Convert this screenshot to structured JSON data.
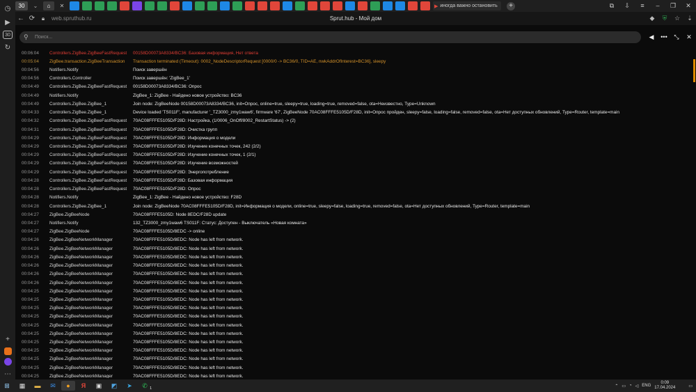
{
  "browser": {
    "url": "web.spruthub.ru",
    "page_title": "Sprut.hub - Мой дом",
    "tab_counter": "30",
    "wide_tab_label": "иногда важно остановить",
    "sidebar_counter": "30"
  },
  "search": {
    "placeholder": "Поиск..."
  },
  "log": [
    {
      "time": "00:06:04",
      "source": "Controllers.ZigBee.ZigBeeFastRequest",
      "message": "00158D00073A8334/BC36: Базовая информация, Нет ответа",
      "level": "error"
    },
    {
      "time": "00:05:04",
      "source": "ZigBee.transaction.ZigBeeTransaction",
      "message": "Transaction terminated (Timeout): 0002_NodeDescriptorRequest [0000/0 -> BC36/0, TID=AE, nwkAddrOfInterest=BC36], sleepy",
      "level": "warn"
    },
    {
      "time": "00:04:56",
      "source": "Notifiers.Notify",
      "message": "Поиск завершён",
      "level": "info"
    },
    {
      "time": "00:04:56",
      "source": "Controllers.Controller",
      "message": "Поиск завершён: 'ZigBee_1'",
      "level": "info"
    },
    {
      "time": "00:04:49",
      "source": "Controllers.ZigBee.ZigBeeFastRequest",
      "message": "00158D00073A8334/BC36: Опрос",
      "level": "info"
    },
    {
      "time": "00:04:49",
      "source": "Notifiers.Notify",
      "message": "ZigBee_1: ZigBee - Найдено новое устройство: BC36",
      "level": "info"
    },
    {
      "time": "00:04:49",
      "source": "Controllers.ZigBee.ZigBee_1",
      "message": "Join node: ZigBeeNode 00158D00073A8334/BC36, init=Опрос, online=true, sleepy=true, loading=true, removed=false, ota=Неизвестно, Type=Unknown",
      "level": "info"
    },
    {
      "time": "00:04:33",
      "source": "Controllers.ZigBee.ZigBee_1",
      "message": "Device loaded 'TS011F', manufacturer '_TZ3000_zmy1waw6', firmware '67', ZigBeeNode 70AC08FFFE5105D/F28D, init=Опрос пройден, sleepy=false, loading=false, removed=false, ota=Нет доступных обновлений, Type=Router, template=main",
      "level": "info"
    },
    {
      "time": "00:04:32",
      "source": "Controllers.ZigBee.ZigBeeFastRequest",
      "message": "70AC08FFFE5105D/F28D: Настройка, (1/0006_OnOff/8002_RestartStatus) -> (2)",
      "level": "info"
    },
    {
      "time": "00:04:31",
      "source": "Controllers.ZigBee.ZigBeeFastRequest",
      "message": "70AC08FFFE5105D/F28D: Очистка групп",
      "level": "info"
    },
    {
      "time": "00:04:29",
      "source": "Controllers.ZigBee.ZigBeeFastRequest",
      "message": "70AC08FFFE5105D/F28D: Информация о модели",
      "level": "info"
    },
    {
      "time": "00:04:29",
      "source": "Controllers.ZigBee.ZigBeeFastRequest",
      "message": "70AC08FFFE5105D/F28D: Изучение конечных точек, 242 (2/2)",
      "level": "info"
    },
    {
      "time": "00:04:29",
      "source": "Controllers.ZigBee.ZigBeeFastRequest",
      "message": "70AC08FFFE5105D/F28D: Изучение конечных точек, 1 (2/1)",
      "level": "info"
    },
    {
      "time": "00:04:29",
      "source": "Controllers.ZigBee.ZigBeeFastRequest",
      "message": "70AC08FFFE5105D/F28D: Изучение возможностей",
      "level": "info"
    },
    {
      "time": "00:04:29",
      "source": "Controllers.ZigBee.ZigBeeFastRequest",
      "message": "70AC08FFFE5105D/F28D: Энергопотребление",
      "level": "info"
    },
    {
      "time": "00:04:28",
      "source": "Controllers.ZigBee.ZigBeeFastRequest",
      "message": "70AC08FFFE5105D/F28D: Базовая информация",
      "level": "info"
    },
    {
      "time": "00:04:28",
      "source": "Controllers.ZigBee.ZigBeeFastRequest",
      "message": "70AC08FFFE5105D/F28D: Опрос",
      "level": "info"
    },
    {
      "time": "00:04:28",
      "source": "Notifiers.Notify",
      "message": "ZigBee_1: ZigBee - Найдено новое устройство: F28D",
      "level": "info"
    },
    {
      "time": "00:04:28",
      "source": "Controllers.ZigBee.ZigBee_1",
      "message": "Join node: ZigBeeNode 70AC08FFFE5105D/F28D, init=Информация о модели, online=true, sleepy=false, loading=true, removed=false, ota=Нет доступных обновлений, Type=Router, template=main",
      "level": "info"
    },
    {
      "time": "00:04:27",
      "source": "ZigBee.ZigBeeNode",
      "message": "70AC08FFFE5105D: Node 8EDC/F28D update",
      "level": "info"
    },
    {
      "time": "00:04:27",
      "source": "Notifiers.Notify",
      "message": "132_TZ3000_zmy1waw6 TS011F: Статус: Доступен - Выключатель «Новая комната»",
      "level": "info"
    },
    {
      "time": "00:04:27",
      "source": "ZigBee.ZigBeeNode",
      "message": "70AC08FFFE5105D/8EDC -> online",
      "level": "info"
    },
    {
      "time": "00:04:26",
      "source": "ZigBee.ZigBeeNetworkManager",
      "message": "70AC08FFFE5105D/8EDC: Node has left from network.",
      "level": "info"
    },
    {
      "time": "00:04:26",
      "source": "ZigBee.ZigBeeNetworkManager",
      "message": "70AC08FFFE5105D/8EDC: Node has left from network.",
      "level": "info"
    },
    {
      "time": "00:04:26",
      "source": "ZigBee.ZigBeeNetworkManager",
      "message": "70AC08FFFE5105D/8EDC: Node has left from network.",
      "level": "info"
    },
    {
      "time": "00:04:26",
      "source": "ZigBee.ZigBeeNetworkManager",
      "message": "70AC08FFFE5105D/8EDC: Node has left from network.",
      "level": "info"
    },
    {
      "time": "00:04:26",
      "source": "ZigBee.ZigBeeNetworkManager",
      "message": "70AC08FFFE5105D/8EDC: Node has left from network.",
      "level": "info"
    },
    {
      "time": "00:04:26",
      "source": "ZigBee.ZigBeeNetworkManager",
      "message": "70AC08FFFE5105D/8EDC: Node has left from network.",
      "level": "info"
    },
    {
      "time": "00:04:25",
      "source": "ZigBee.ZigBeeNetworkManager",
      "message": "70AC08FFFE5105D/8EDC: Node has left from network.",
      "level": "info"
    },
    {
      "time": "00:04:25",
      "source": "ZigBee.ZigBeeNetworkManager",
      "message": "70AC08FFFE5105D/8EDC: Node has left from network.",
      "level": "info"
    },
    {
      "time": "00:04:25",
      "source": "ZigBee.ZigBeeNetworkManager",
      "message": "70AC08FFFE5105D/8EDC: Node has left from network.",
      "level": "info"
    },
    {
      "time": "00:04:25",
      "source": "ZigBee.ZigBeeNetworkManager",
      "message": "70AC08FFFE5105D/8EDC: Node has left from network.",
      "level": "info"
    },
    {
      "time": "00:04:25",
      "source": "ZigBee.ZigBeeNetworkManager",
      "message": "70AC08FFFE5105D/8EDC: Node has left from network.",
      "level": "info"
    },
    {
      "time": "00:04:25",
      "source": "ZigBee.ZigBeeNetworkManager",
      "message": "70AC08FFFE5105D/8EDC: Node has left from network.",
      "level": "info"
    },
    {
      "time": "00:04:25",
      "source": "ZigBee.ZigBeeNetworkManager",
      "message": "70AC08FFFE5105D/8EDC: Node has left from network.",
      "level": "info"
    },
    {
      "time": "00:04:25",
      "source": "ZigBee.ZigBeeNetworkManager",
      "message": "70AC08FFFE5105D/8EDC: Node has left from network.",
      "level": "info"
    },
    {
      "time": "00:04:25",
      "source": "ZigBee.ZigBeeNetworkManager",
      "message": "70AC08FFFE5105D/8EDC: Node has left from network.",
      "level": "info"
    },
    {
      "time": "00:04:25",
      "source": "ZigBee.ZigBeeNetworkManager",
      "message": "70AC08FFFE5105D/8EDC: Node has left from network.",
      "level": "info"
    },
    {
      "time": "00:04:25",
      "source": "ZigBee.ZigBeeNetworkManager",
      "message": "70AC08FFFE5105D/8EDC: Node has left from network.",
      "level": "info"
    }
  ],
  "taskbar": {
    "lang": "ENG",
    "time": "0:09",
    "date": "17.04.2024",
    "notification_count": "1",
    "yandex_label": "Я"
  }
}
